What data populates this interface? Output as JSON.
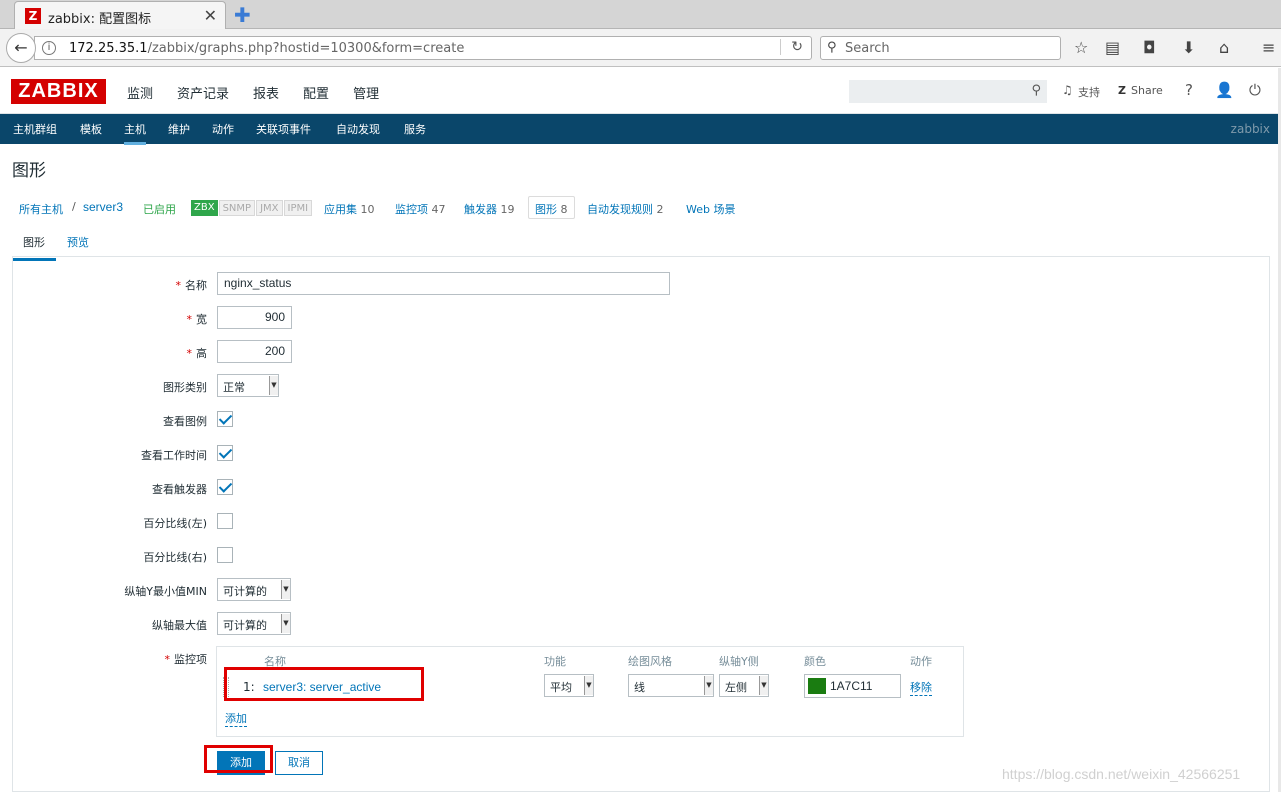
{
  "browser": {
    "tab_title": "zabbix: 配置图标",
    "tab_favicon": "Z",
    "url_host": "172.25.35.1",
    "url_path": "/zabbix/graphs.php?hostid=10300&form=create",
    "search_placeholder": "Search"
  },
  "header": {
    "logo": "ZABBIX",
    "menu": [
      "监测",
      "资产记录",
      "报表",
      "配置",
      "管理"
    ],
    "support": "支持",
    "share": "Share",
    "help": "?"
  },
  "submenu": {
    "items": [
      "主机群组",
      "模板",
      "主机",
      "维护",
      "动作",
      "关联项事件",
      "自动发现",
      "服务"
    ],
    "right": "zabbix"
  },
  "page_title": "图形",
  "breadcrumb": {
    "all_hosts": "所有主机",
    "sep": "/",
    "host": "server3",
    "status": "已启用",
    "badges": [
      "ZBX",
      "SNMP",
      "JMX",
      "IPMI"
    ],
    "applications": "应用集",
    "applications_count": "10",
    "items": "监控项",
    "items_count": "47",
    "triggers": "触发器",
    "triggers_count": "19",
    "graphs": "图形",
    "graphs_count": "8",
    "discovery": "自动发现规则",
    "discovery_count": "2",
    "web": "Web 场景"
  },
  "tabs": {
    "graph": "图形",
    "preview": "预览"
  },
  "form": {
    "name_label": "名称",
    "name_value": "nginx_status",
    "width_label": "宽",
    "width_value": "900",
    "height_label": "高",
    "height_value": "200",
    "type_label": "图形类别",
    "type_value": "正常",
    "show_legend_label": "查看图例",
    "show_worktime_label": "查看工作时间",
    "show_triggers_label": "查看触发器",
    "percent_left_label": "百分比线(左)",
    "percent_right_label": "百分比线(右)",
    "ymin_label": "纵轴Y最小值MIN",
    "ymin_value": "可计算的",
    "ymax_label": "纵轴最大值",
    "ymax_value": "可计算的",
    "items_label": "监控项"
  },
  "items_table": {
    "headers": [
      "名称",
      "功能",
      "绘图风格",
      "纵轴Y侧",
      "颜色",
      "动作"
    ],
    "row": {
      "num": "1:",
      "name": "server3: server_active",
      "function": "平均",
      "style": "线",
      "y_side": "左侧",
      "color": "1A7C11",
      "remove": "移除"
    },
    "add": "添加"
  },
  "buttons": {
    "add": "添加",
    "cancel": "取消"
  },
  "watermark": "https://blog.csdn.net/weixin_42566251"
}
